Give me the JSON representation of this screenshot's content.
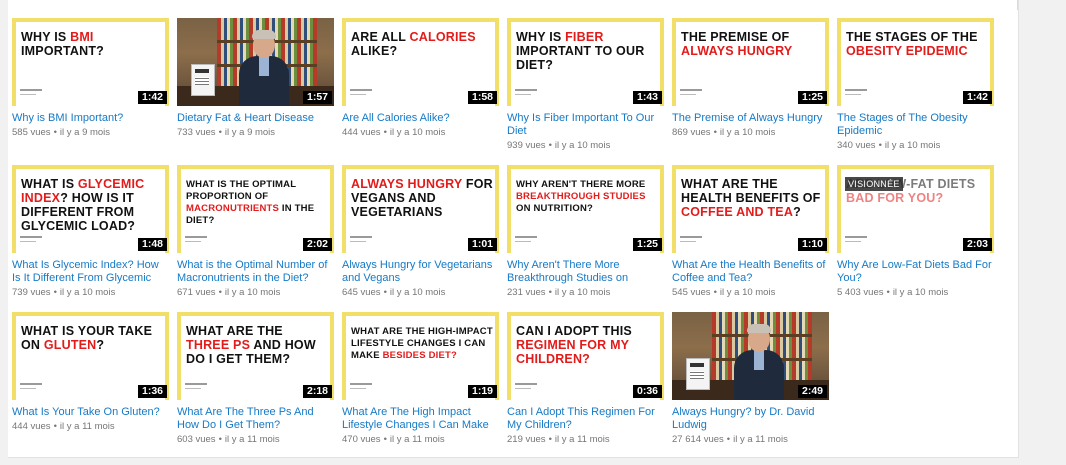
{
  "videos": [
    {
      "thumb_pre": "WHY IS ",
      "thumb_hl": "BMI",
      "thumb_post": " IMPORTANT?",
      "duration": "1:42",
      "title": "Why is BMI Important?",
      "views": "585 vues",
      "age": "il y a 9 mois",
      "kind": "text"
    },
    {
      "duration": "1:57",
      "title": "Dietary Fat & Heart Disease",
      "views": "733 vues",
      "age": "il y a 9 mois",
      "kind": "photo",
      "book_text": "Always Hungry"
    },
    {
      "thumb_pre": "ARE ALL ",
      "thumb_hl": "CALORIES",
      "thumb_post": " ALIKE?",
      "duration": "1:58",
      "title": "Are All Calories Alike?",
      "views": "444 vues",
      "age": "il y a 10 mois",
      "kind": "text"
    },
    {
      "thumb_pre": "WHY IS ",
      "thumb_hl": "FIBER",
      "thumb_post": " IMPORTANT TO OUR DIET?",
      "duration": "1:43",
      "title": "Why Is Fiber Important To Our Diet",
      "views": "939 vues",
      "age": "il y a 10 mois",
      "kind": "text"
    },
    {
      "thumb_pre": "THE PREMISE OF ",
      "thumb_hl": "ALWAYS HUNGRY",
      "thumb_post": "",
      "duration": "1:25",
      "title": "The Premise of Always Hungry",
      "views": "869 vues",
      "age": "il y a 10 mois",
      "kind": "text"
    },
    {
      "thumb_pre": "THE STAGES OF THE ",
      "thumb_hl": "OBESITY EPIDEMIC",
      "thumb_post": "",
      "duration": "1:42",
      "title": "The Stages of The Obesity Epidemic",
      "views": "340 vues",
      "age": "il y a 10 mois",
      "kind": "text"
    },
    {
      "thumb_pre": "WHAT IS ",
      "thumb_hl": "GLYCEMIC INDEX",
      "thumb_post": "? HOW IS IT DIFFERENT FROM GLYCEMIC LOAD?",
      "duration": "1:48",
      "title": "What Is Glycemic Index? How Is It Different From Glycemic Load?",
      "views": "739 vues",
      "age": "il y a 10 mois",
      "kind": "text"
    },
    {
      "thumb_pre": "WHAT IS THE OPTIMAL PROPORTION OF ",
      "thumb_hl": "MACRONUTRIENTS",
      "thumb_post": " IN THE DIET?",
      "duration": "2:02",
      "title": "What is the Optimal Number of Macronutrients in the Diet?",
      "views": "671 vues",
      "age": "il y a 10 mois",
      "kind": "text",
      "small": true
    },
    {
      "thumb_pre": "",
      "thumb_hl": "ALWAYS HUNGRY",
      "thumb_post": " FOR VEGANS AND VEGETARIANS",
      "duration": "1:01",
      "title": "Always Hungry for Vegetarians and Vegans",
      "views": "645 vues",
      "age": "il y a 10 mois",
      "kind": "text"
    },
    {
      "thumb_pre": "WHY AREN'T THERE MORE ",
      "thumb_hl": "BREAKTHROUGH STUDIES",
      "thumb_post": " ON NUTRITION?",
      "duration": "1:25",
      "title": "Why Aren't There More Breakthrough Studies on Nutrition?",
      "views": "231 vues",
      "age": "il y a 10 mois",
      "kind": "text",
      "small": true
    },
    {
      "thumb_pre": "WHAT ARE THE HEALTH BENEFITS OF ",
      "thumb_hl": "COFFEE AND TEA",
      "thumb_post": "?",
      "duration": "1:10",
      "title": "What Are the Health Benefits of Coffee and Tea?",
      "views": "545 vues",
      "age": "il y a 10 mois",
      "kind": "text"
    },
    {
      "thumb_pre": "ARE LOW-FAT DIETS ",
      "thumb_hl": "BAD FOR YOU?",
      "thumb_post": "",
      "duration": "2:03",
      "title": "Why Are Low-Fat Diets Bad For You?",
      "views": "5 403 vues",
      "age": "il y a 10 mois",
      "kind": "text",
      "watched": "VISIONNÉE"
    },
    {
      "thumb_pre": "WHAT IS YOUR TAKE ON ",
      "thumb_hl": "GLUTEN",
      "thumb_post": "?",
      "duration": "1:36",
      "title": "What Is Your Take On Gluten?",
      "views": "444 vues",
      "age": "il y a 11 mois",
      "kind": "text"
    },
    {
      "thumb_pre": "WHAT ARE THE ",
      "thumb_hl": "THREE PS",
      "thumb_post": " AND HOW DO I GET THEM?",
      "duration": "2:18",
      "title": "What Are The Three Ps And How Do I Get Them?",
      "views": "603 vues",
      "age": "il y a 11 mois",
      "kind": "text"
    },
    {
      "thumb_pre": "WHAT ARE THE HIGH-IMPACT LIFESTYLE CHANGES I CAN MAKE ",
      "thumb_hl": "BESIDES DIET?",
      "thumb_post": "",
      "duration": "1:19",
      "title": "What Are The High Impact Lifestyle Changes I Can Make Besides Diet?",
      "views": "470 vues",
      "age": "il y a 11 mois",
      "kind": "text",
      "small": true
    },
    {
      "thumb_pre": "CAN I ADOPT THIS ",
      "thumb_hl": "REGIMEN FOR MY CHILDREN?",
      "thumb_post": "",
      "duration": "0:36",
      "title": "Can I Adopt This Regimen For My Children?",
      "views": "219 vues",
      "age": "il y a 11 mois",
      "kind": "text"
    },
    {
      "duration": "2:49",
      "title": "Always Hungry? by Dr. David Ludwig",
      "views": "27 614 vues",
      "age": "il y a 11 mois",
      "kind": "photo",
      "book_text": "Always Hungry?"
    }
  ],
  "colors": {
    "frame": "#f2df6a",
    "highlight": "#e21b1b",
    "link": "#167ac6",
    "meta": "#767676"
  }
}
